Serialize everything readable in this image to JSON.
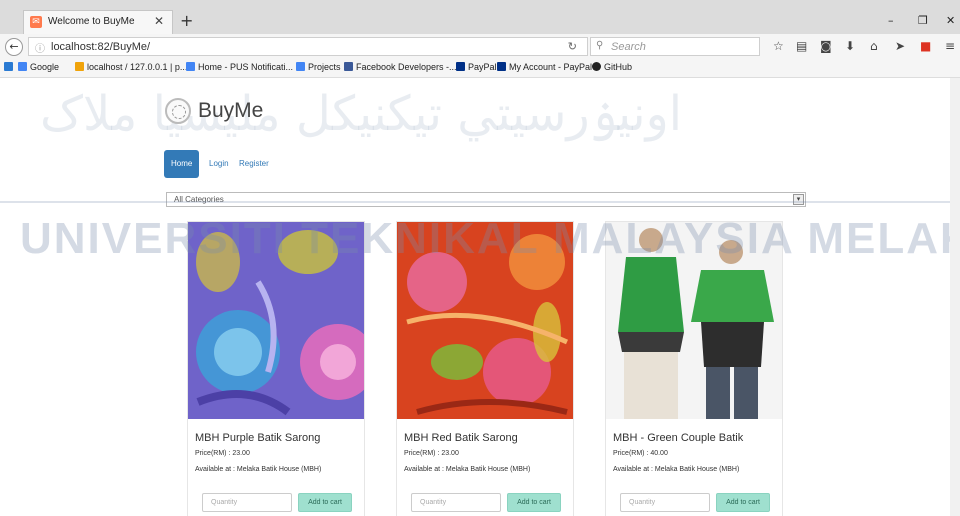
{
  "browser": {
    "tab_title": "Welcome to BuyMe",
    "tab_close": "✕",
    "new_tab": "+",
    "url": "localhost:82/BuyMe/",
    "search_placeholder": "Search",
    "window_controls": [
      "–",
      "❐",
      "✕"
    ],
    "bookmarks": [
      {
        "label": "Google",
        "icon": "google-icon",
        "color": "#4285f4"
      },
      {
        "label": "localhost / 127.0.0.1 | p...",
        "icon": "phpmyadmin-icon",
        "color": "#f0a30a"
      },
      {
        "label": "Home - PUS Notificati...",
        "icon": "google-icon",
        "color": "#4285f4"
      },
      {
        "label": "Projects",
        "icon": "google-icon",
        "color": "#4285f4"
      },
      {
        "label": "Facebook Developers -...",
        "icon": "facebook-icon",
        "color": "#3b5998"
      },
      {
        "label": "PayPal",
        "icon": "paypal-icon",
        "color": "#003087"
      },
      {
        "label": "My Account - PayPal",
        "icon": "paypal-icon",
        "color": "#003087"
      },
      {
        "label": "GitHub",
        "icon": "github-icon",
        "color": "#222222"
      }
    ]
  },
  "site": {
    "brand": "BuyMe",
    "nav": [
      "Home",
      "Login",
      "Register"
    ],
    "active_nav": "Home",
    "category_select": "All Categories"
  },
  "products": [
    {
      "name": "MBH Purple Batik Sarong",
      "price": "Price(RM) : 23.00",
      "store": "Available at : Melaka Batik House (MBH)",
      "qty_placeholder": "Quantity",
      "button": "Add to cart"
    },
    {
      "name": "MBH Red Batik Sarong",
      "price": "Price(RM) : 23.00",
      "store": "Available at : Melaka Batik House (MBH)",
      "qty_placeholder": "Quantity",
      "button": "Add to cart"
    },
    {
      "name": "MBH - Green Couple Batik",
      "price": "Price(RM) : 40.00",
      "store": "Available at : Melaka Batik House (MBH)",
      "qty_placeholder": "Quantity",
      "button": "Add to cart"
    }
  ],
  "watermark": {
    "latin": "UNIVERSITI TEKNIKAL MALAYSIA MELAKA",
    "arabic": "اونيۏرسيتي تيکنيکل مليسيا ملاک"
  },
  "colors": {
    "accent": "#337ab7",
    "add_button": "#9fe0cf"
  }
}
